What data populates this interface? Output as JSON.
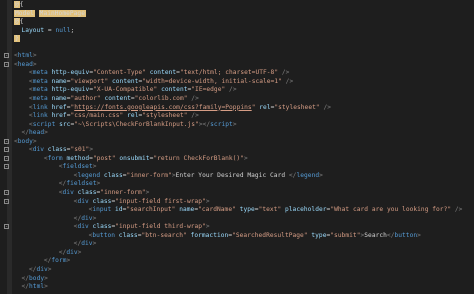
{
  "editor": {
    "lines": [
      {
        "indent": 0,
        "fold": "",
        "tokens": [
          {
            "t": "@",
            "c": "tok-at hl"
          },
          {
            "t": "{",
            "c": "tok-at"
          }
        ]
      },
      {
        "indent": 0,
        "fold": "",
        "tokens": [
          {
            "t": "Model",
            "c": "tok-kw hl"
          },
          {
            "t": " ",
            "c": "tok-text"
          },
          {
            "t": "MainHomePage",
            "c": "tok-kw hl"
          }
        ]
      },
      {
        "indent": 0,
        "fold": "",
        "tokens": [
          {
            "t": "@",
            "c": "tok-at hl"
          },
          {
            "t": "{",
            "c": "tok-at"
          }
        ]
      },
      {
        "indent": 1,
        "fold": "",
        "tokens": [
          {
            "t": "Layout",
            "c": "tok-prop"
          },
          {
            "t": " = ",
            "c": "tok-punct"
          },
          {
            "t": "null",
            "c": "tok-null"
          },
          {
            "t": ";",
            "c": "tok-punct"
          }
        ]
      },
      {
        "indent": 0,
        "fold": "",
        "tokens": [
          {
            "t": "}",
            "c": "tok-at hl"
          }
        ]
      },
      {
        "indent": 0,
        "fold": "",
        "tokens": []
      },
      {
        "indent": 0,
        "fold": "-",
        "tokens": [
          {
            "t": "<",
            "c": "tok-bracket"
          },
          {
            "t": "html",
            "c": "tok-tag"
          },
          {
            "t": ">",
            "c": "tok-bracket"
          }
        ]
      },
      {
        "indent": 0,
        "fold": "-",
        "tokens": [
          {
            "t": "<",
            "c": "tok-bracket"
          },
          {
            "t": "head",
            "c": "tok-tag"
          },
          {
            "t": ">",
            "c": "tok-bracket"
          }
        ]
      },
      {
        "indent": 2,
        "fold": "",
        "tokens": [
          {
            "t": "<",
            "c": "tok-bracket"
          },
          {
            "t": "meta",
            "c": "tok-tag"
          },
          {
            "t": " http-equiv",
            "c": "tok-attr"
          },
          {
            "t": "=",
            "c": "tok-punct"
          },
          {
            "t": "\"Content-Type\"",
            "c": "tok-value"
          },
          {
            "t": " content",
            "c": "tok-attr"
          },
          {
            "t": "=",
            "c": "tok-punct"
          },
          {
            "t": "\"text/html; charset=UTF-8\"",
            "c": "tok-value"
          },
          {
            "t": " />",
            "c": "tok-bracket"
          }
        ]
      },
      {
        "indent": 2,
        "fold": "",
        "tokens": [
          {
            "t": "<",
            "c": "tok-bracket"
          },
          {
            "t": "meta",
            "c": "tok-tag"
          },
          {
            "t": " name",
            "c": "tok-attr"
          },
          {
            "t": "=",
            "c": "tok-punct"
          },
          {
            "t": "\"viewport\"",
            "c": "tok-value"
          },
          {
            "t": " content",
            "c": "tok-attr"
          },
          {
            "t": "=",
            "c": "tok-punct"
          },
          {
            "t": "\"width=device-width, initial-scale=1\"",
            "c": "tok-value"
          },
          {
            "t": " />",
            "c": "tok-bracket"
          }
        ]
      },
      {
        "indent": 2,
        "fold": "",
        "tokens": [
          {
            "t": "<",
            "c": "tok-bracket"
          },
          {
            "t": "meta",
            "c": "tok-tag"
          },
          {
            "t": " http-equiv",
            "c": "tok-attr"
          },
          {
            "t": "=",
            "c": "tok-punct"
          },
          {
            "t": "\"X-UA-Compatible\"",
            "c": "tok-value"
          },
          {
            "t": " content",
            "c": "tok-attr"
          },
          {
            "t": "=",
            "c": "tok-punct"
          },
          {
            "t": "\"IE=edge\"",
            "c": "tok-value"
          },
          {
            "t": " />",
            "c": "tok-bracket"
          }
        ]
      },
      {
        "indent": 2,
        "fold": "",
        "tokens": [
          {
            "t": "<",
            "c": "tok-bracket"
          },
          {
            "t": "meta",
            "c": "tok-tag"
          },
          {
            "t": " name",
            "c": "tok-attr"
          },
          {
            "t": "=",
            "c": "tok-punct"
          },
          {
            "t": "\"author\"",
            "c": "tok-value"
          },
          {
            "t": " content",
            "c": "tok-attr"
          },
          {
            "t": "=",
            "c": "tok-punct"
          },
          {
            "t": "\"colorlib.com\"",
            "c": "tok-value"
          },
          {
            "t": " />",
            "c": "tok-bracket"
          }
        ]
      },
      {
        "indent": 2,
        "fold": "",
        "tokens": [
          {
            "t": "<",
            "c": "tok-bracket"
          },
          {
            "t": "link",
            "c": "tok-tag"
          },
          {
            "t": " href",
            "c": "tok-attr"
          },
          {
            "t": "=",
            "c": "tok-punct"
          },
          {
            "t": "\"",
            "c": "tok-value"
          },
          {
            "t": "https://fonts.googleapis.com/css?family=Poppins",
            "c": "tok-link"
          },
          {
            "t": "\"",
            "c": "tok-value"
          },
          {
            "t": " rel",
            "c": "tok-attr"
          },
          {
            "t": "=",
            "c": "tok-punct"
          },
          {
            "t": "\"stylesheet\"",
            "c": "tok-value"
          },
          {
            "t": " />",
            "c": "tok-bracket"
          }
        ]
      },
      {
        "indent": 2,
        "fold": "",
        "tokens": [
          {
            "t": "<",
            "c": "tok-bracket"
          },
          {
            "t": "link",
            "c": "tok-tag"
          },
          {
            "t": " href",
            "c": "tok-attr"
          },
          {
            "t": "=",
            "c": "tok-punct"
          },
          {
            "t": "\"css/main.css\"",
            "c": "tok-value"
          },
          {
            "t": " rel",
            "c": "tok-attr"
          },
          {
            "t": "=",
            "c": "tok-punct"
          },
          {
            "t": "\"stylesheet\"",
            "c": "tok-value"
          },
          {
            "t": " />",
            "c": "tok-bracket"
          }
        ]
      },
      {
        "indent": 2,
        "fold": "",
        "tokens": [
          {
            "t": "<",
            "c": "tok-bracket"
          },
          {
            "t": "script",
            "c": "tok-tag"
          },
          {
            "t": " src",
            "c": "tok-attr"
          },
          {
            "t": "=",
            "c": "tok-punct"
          },
          {
            "t": "\"~\\Scripts\\CheckForBlankInput.js\"",
            "c": "tok-value"
          },
          {
            "t": "></",
            "c": "tok-bracket"
          },
          {
            "t": "script",
            "c": "tok-tag"
          },
          {
            "t": ">",
            "c": "tok-bracket"
          }
        ]
      },
      {
        "indent": 1,
        "fold": "",
        "tokens": [
          {
            "t": "</",
            "c": "tok-bracket"
          },
          {
            "t": "head",
            "c": "tok-tag"
          },
          {
            "t": ">",
            "c": "tok-bracket"
          }
        ]
      },
      {
        "indent": 0,
        "fold": "-",
        "tokens": [
          {
            "t": "<",
            "c": "tok-bracket"
          },
          {
            "t": "body",
            "c": "tok-tag"
          },
          {
            "t": ">",
            "c": "tok-bracket"
          }
        ]
      },
      {
        "indent": 2,
        "fold": "-",
        "tokens": [
          {
            "t": "<",
            "c": "tok-bracket"
          },
          {
            "t": "div",
            "c": "tok-tag"
          },
          {
            "t": " class",
            "c": "tok-attr"
          },
          {
            "t": "=",
            "c": "tok-punct"
          },
          {
            "t": "\"s01\"",
            "c": "tok-value"
          },
          {
            "t": ">",
            "c": "tok-bracket"
          }
        ]
      },
      {
        "indent": 4,
        "fold": "-",
        "tokens": [
          {
            "t": "<",
            "c": "tok-bracket"
          },
          {
            "t": "form",
            "c": "tok-tag"
          },
          {
            "t": " method",
            "c": "tok-attr"
          },
          {
            "t": "=",
            "c": "tok-punct"
          },
          {
            "t": "\"post\"",
            "c": "tok-value"
          },
          {
            "t": " onsubmit",
            "c": "tok-attr"
          },
          {
            "t": "=",
            "c": "tok-punct"
          },
          {
            "t": "\"return CheckForBlank()\"",
            "c": "tok-value"
          },
          {
            "t": ">",
            "c": "tok-bracket"
          }
        ]
      },
      {
        "indent": 6,
        "fold": "-",
        "tokens": [
          {
            "t": "<",
            "c": "tok-bracket"
          },
          {
            "t": "fieldset",
            "c": "tok-tag"
          },
          {
            "t": ">",
            "c": "tok-bracket"
          }
        ]
      },
      {
        "indent": 8,
        "fold": "",
        "tokens": [
          {
            "t": "<",
            "c": "tok-bracket"
          },
          {
            "t": "legend",
            "c": "tok-tag"
          },
          {
            "t": " class",
            "c": "tok-attr"
          },
          {
            "t": "=",
            "c": "tok-punct"
          },
          {
            "t": "\"inner-form\"",
            "c": "tok-value"
          },
          {
            "t": ">",
            "c": "tok-bracket"
          },
          {
            "t": "Enter Your Desired Magic Card ",
            "c": "tok-text"
          },
          {
            "t": "</",
            "c": "tok-bracket"
          },
          {
            "t": "legend",
            "c": "tok-tag"
          },
          {
            "t": ">",
            "c": "tok-bracket"
          }
        ]
      },
      {
        "indent": 6,
        "fold": "",
        "tokens": [
          {
            "t": "</",
            "c": "tok-bracket"
          },
          {
            "t": "fieldset",
            "c": "tok-tag"
          },
          {
            "t": ">",
            "c": "tok-bracket"
          }
        ]
      },
      {
        "indent": 6,
        "fold": "-",
        "tokens": [
          {
            "t": "<",
            "c": "tok-bracket"
          },
          {
            "t": "div",
            "c": "tok-tag"
          },
          {
            "t": " class",
            "c": "tok-attr"
          },
          {
            "t": "=",
            "c": "tok-punct"
          },
          {
            "t": "\"inner-form\"",
            "c": "tok-value"
          },
          {
            "t": ">",
            "c": "tok-bracket"
          }
        ]
      },
      {
        "indent": 8,
        "fold": "-",
        "tokens": [
          {
            "t": "<",
            "c": "tok-bracket"
          },
          {
            "t": "div",
            "c": "tok-tag"
          },
          {
            "t": " class",
            "c": "tok-attr"
          },
          {
            "t": "=",
            "c": "tok-punct"
          },
          {
            "t": "\"input-field first-wrap\"",
            "c": "tok-value"
          },
          {
            "t": ">",
            "c": "tok-bracket"
          }
        ]
      },
      {
        "indent": 10,
        "fold": "",
        "tokens": [
          {
            "t": "<",
            "c": "tok-bracket"
          },
          {
            "t": "input",
            "c": "tok-tag"
          },
          {
            "t": " id",
            "c": "tok-attr"
          },
          {
            "t": "=",
            "c": "tok-punct"
          },
          {
            "t": "\"searchInput\"",
            "c": "tok-value"
          },
          {
            "t": " name",
            "c": "tok-attr"
          },
          {
            "t": "=",
            "c": "tok-punct"
          },
          {
            "t": "\"cardName\"",
            "c": "tok-value"
          },
          {
            "t": " type",
            "c": "tok-attr"
          },
          {
            "t": "=",
            "c": "tok-punct"
          },
          {
            "t": "\"text\"",
            "c": "tok-value"
          },
          {
            "t": " placeholder",
            "c": "tok-attr"
          },
          {
            "t": "=",
            "c": "tok-punct"
          },
          {
            "t": "\"What card are you looking for?\"",
            "c": "tok-value"
          },
          {
            "t": " />",
            "c": "tok-bracket"
          }
        ]
      },
      {
        "indent": 8,
        "fold": "",
        "tokens": [
          {
            "t": "</",
            "c": "tok-bracket"
          },
          {
            "t": "div",
            "c": "tok-tag"
          },
          {
            "t": ">",
            "c": "tok-bracket"
          }
        ]
      },
      {
        "indent": 8,
        "fold": "-",
        "tokens": [
          {
            "t": "<",
            "c": "tok-bracket"
          },
          {
            "t": "div",
            "c": "tok-tag"
          },
          {
            "t": " class",
            "c": "tok-attr"
          },
          {
            "t": "=",
            "c": "tok-punct"
          },
          {
            "t": "\"input-field third-wrap\"",
            "c": "tok-value"
          },
          {
            "t": ">",
            "c": "tok-bracket"
          }
        ]
      },
      {
        "indent": 10,
        "fold": "",
        "tokens": [
          {
            "t": "<",
            "c": "tok-bracket"
          },
          {
            "t": "button",
            "c": "tok-tag"
          },
          {
            "t": " class",
            "c": "tok-attr"
          },
          {
            "t": "=",
            "c": "tok-punct"
          },
          {
            "t": "\"btn-search\"",
            "c": "tok-value"
          },
          {
            "t": " formaction",
            "c": "tok-attr"
          },
          {
            "t": "=",
            "c": "tok-punct"
          },
          {
            "t": "\"SearchedResultPage\"",
            "c": "tok-value"
          },
          {
            "t": " type",
            "c": "tok-attr"
          },
          {
            "t": "=",
            "c": "tok-punct"
          },
          {
            "t": "\"submit\"",
            "c": "tok-value"
          },
          {
            "t": ">",
            "c": "tok-bracket"
          },
          {
            "t": "Search",
            "c": "tok-text"
          },
          {
            "t": "</",
            "c": "tok-bracket"
          },
          {
            "t": "button",
            "c": "tok-tag"
          },
          {
            "t": ">",
            "c": "tok-bracket"
          }
        ]
      },
      {
        "indent": 8,
        "fold": "",
        "tokens": [
          {
            "t": "</",
            "c": "tok-bracket"
          },
          {
            "t": "div",
            "c": "tok-tag"
          },
          {
            "t": ">",
            "c": "tok-bracket"
          }
        ]
      },
      {
        "indent": 6,
        "fold": "",
        "tokens": [
          {
            "t": "</",
            "c": "tok-bracket"
          },
          {
            "t": "div",
            "c": "tok-tag"
          },
          {
            "t": ">",
            "c": "tok-bracket"
          }
        ]
      },
      {
        "indent": 4,
        "fold": "",
        "tokens": [
          {
            "t": "</",
            "c": "tok-bracket"
          },
          {
            "t": "form",
            "c": "tok-tag"
          },
          {
            "t": ">",
            "c": "tok-bracket"
          }
        ]
      },
      {
        "indent": 2,
        "fold": "",
        "tokens": [
          {
            "t": "</",
            "c": "tok-bracket"
          },
          {
            "t": "div",
            "c": "tok-tag"
          },
          {
            "t": ">",
            "c": "tok-bracket"
          }
        ]
      },
      {
        "indent": 1,
        "fold": "",
        "tokens": [
          {
            "t": "</",
            "c": "tok-bracket"
          },
          {
            "t": "body",
            "c": "tok-tag"
          },
          {
            "t": ">",
            "c": "tok-bracket"
          }
        ]
      },
      {
        "indent": 1,
        "fold": "",
        "tokens": [
          {
            "t": "</",
            "c": "tok-bracket"
          },
          {
            "t": "html",
            "c": "tok-tag"
          },
          {
            "t": ">",
            "c": "tok-bracket"
          }
        ]
      }
    ]
  }
}
